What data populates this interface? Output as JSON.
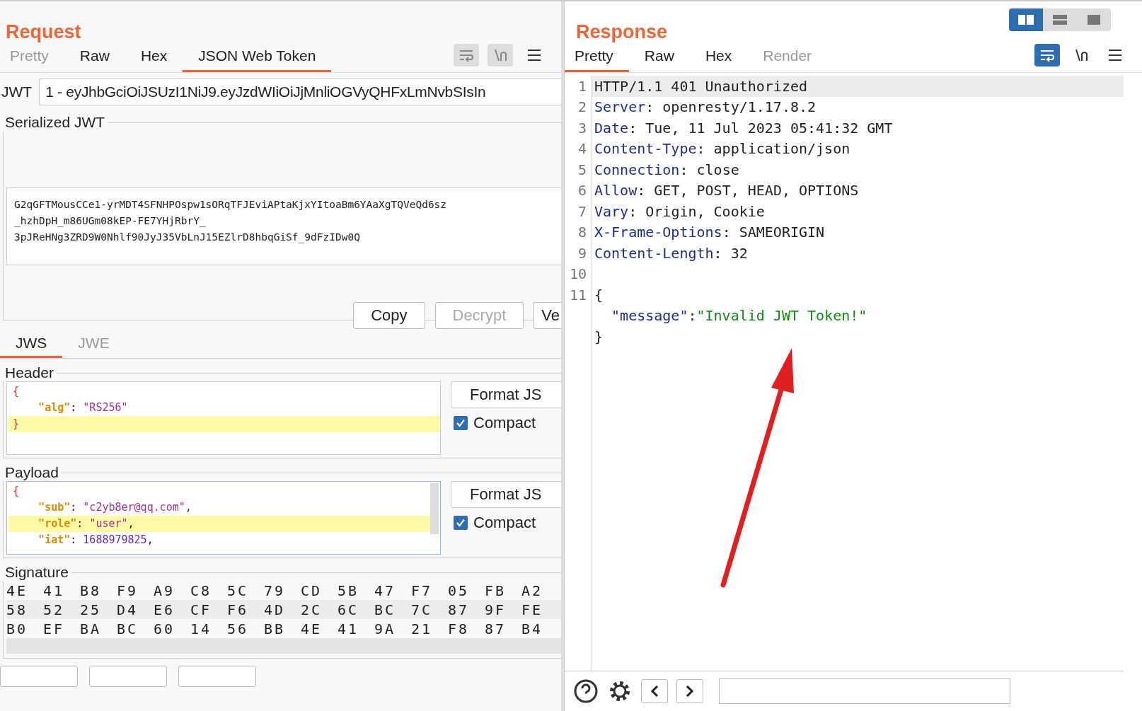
{
  "request": {
    "title": "Request",
    "tabs": [
      {
        "label": "Pretty",
        "selected": false,
        "disabled": true
      },
      {
        "label": "Raw",
        "selected": false,
        "disabled": false
      },
      {
        "label": "Hex",
        "selected": false,
        "disabled": false
      },
      {
        "label": "JSON Web Token",
        "selected": true,
        "disabled": false
      }
    ],
    "toolbar": [
      {
        "kind": "wrap",
        "on": false,
        "disabled": true
      },
      {
        "kind": "newline",
        "on": false,
        "disabled": true
      },
      {
        "kind": "menu",
        "on": false,
        "disabled": false
      }
    ],
    "jwt_field": {
      "label": "JWT",
      "value": "1 - eyJhbGciOiJSUzI1NiJ9.eyJzdWIiOiJjMnliOGVyQHFxLmNvbSIsIn"
    },
    "serialized": {
      "legend": "Serialized JWT",
      "lines": [
        "G2qGFTMousCCe1-yrMDT4SFNHPOspw1sORqTFJEviAPtaKjxYItoaBm6YAaXgTQVeQd6sz",
        "_hzhDpH_m86UGm08kEP-FE7YHjRbrY_",
        "3pJReHNg3ZRD9W0Nhlf90JyJ35VbLnJ15EZlrD8hbqGiSf_9dFzIDw0Q"
      ],
      "buttons": [
        {
          "label": "Copy",
          "disabled": false
        },
        {
          "label": "Decrypt",
          "disabled": true
        },
        {
          "label": "Ve",
          "disabled": false
        }
      ]
    },
    "sub_tabs": [
      {
        "label": "JWS",
        "selected": true
      },
      {
        "label": "JWE",
        "selected": false
      }
    ],
    "header": {
      "legend": "Header",
      "format_button": "Format JS",
      "compact": {
        "label": "Compact",
        "checked": true
      },
      "lines": [
        {
          "highlighted": false,
          "tokens": [
            {
              "kind": "brace",
              "text": "{"
            }
          ]
        },
        {
          "highlighted": false,
          "tokens": [
            {
              "kind": "key",
              "text": "    \"alg\""
            },
            {
              "kind": "punct",
              "text": ": "
            },
            {
              "kind": "string",
              "text": "\"RS256\""
            }
          ]
        },
        {
          "highlighted": true,
          "tokens": [
            {
              "kind": "brace",
              "text": "}"
            }
          ]
        }
      ]
    },
    "payload": {
      "legend": "Payload",
      "format_button": "Format JS",
      "compact": {
        "label": "Compact",
        "checked": true
      },
      "lines": [
        {
          "highlighted": false,
          "tokens": [
            {
              "kind": "brace",
              "text": "{"
            }
          ]
        },
        {
          "highlighted": false,
          "tokens": [
            {
              "kind": "key",
              "text": "    \"sub\""
            },
            {
              "kind": "punct",
              "text": ": "
            },
            {
              "kind": "string",
              "text": "\"c2yb8er@qq.com\""
            },
            {
              "kind": "punct",
              "text": ","
            }
          ]
        },
        {
          "highlighted": true,
          "tokens": [
            {
              "kind": "key",
              "text": "    \"role\""
            },
            {
              "kind": "punct",
              "text": ": "
            },
            {
              "kind": "string",
              "text": "\"user\""
            },
            {
              "kind": "punct",
              "text": ","
            }
          ]
        },
        {
          "highlighted": false,
          "tokens": [
            {
              "kind": "key",
              "text": "    \"iat\""
            },
            {
              "kind": "punct",
              "text": ": "
            },
            {
              "kind": "number",
              "text": "1688979825"
            },
            {
              "kind": "punct",
              "text": ","
            }
          ]
        }
      ]
    },
    "signature": {
      "legend": "Signature",
      "rows": [
        [
          "4E",
          "41",
          "B8",
          "F9",
          "A9",
          "C8",
          "5C",
          "79",
          "CD",
          "5B",
          "47",
          "F7",
          "05",
          "FB",
          "A2"
        ],
        [
          "58",
          "52",
          "25",
          "D4",
          "E6",
          "CF",
          "F6",
          "4D",
          "2C",
          "6C",
          "BC",
          "7C",
          "87",
          "9F",
          "FE"
        ],
        [
          "B0",
          "EF",
          "BA",
          "BC",
          "60",
          "14",
          "56",
          "BB",
          "4E",
          "41",
          "9A",
          "21",
          "F8",
          "87",
          "B4"
        ]
      ]
    }
  },
  "response": {
    "title": "Response",
    "view_modes": [
      {
        "kind": "split",
        "selected": true
      },
      {
        "kind": "stacked",
        "selected": false
      },
      {
        "kind": "single",
        "selected": false
      }
    ],
    "tabs": [
      {
        "label": "Pretty",
        "selected": true,
        "disabled": false
      },
      {
        "label": "Raw",
        "selected": false,
        "disabled": false
      },
      {
        "label": "Hex",
        "selected": false,
        "disabled": false
      },
      {
        "label": "Render",
        "selected": false,
        "disabled": true
      }
    ],
    "toolbar": [
      {
        "kind": "wrap",
        "on": true,
        "disabled": false
      },
      {
        "kind": "newline",
        "on": false,
        "disabled": false
      },
      {
        "kind": "menu",
        "on": false,
        "disabled": false
      }
    ],
    "lines": [
      {
        "number": "1",
        "highlighted": true,
        "tokens": [
          {
            "kind": "text",
            "text": "HTTP/1.1 401 Unauthorized"
          }
        ]
      },
      {
        "number": "2",
        "highlighted": false,
        "tokens": [
          {
            "kind": "name",
            "text": "Server"
          },
          {
            "kind": "text",
            "text": ": openresty/1.17.8.2"
          }
        ]
      },
      {
        "number": "3",
        "highlighted": false,
        "tokens": [
          {
            "kind": "name",
            "text": "Date"
          },
          {
            "kind": "text",
            "text": ": Tue, 11 Jul 2023 05:41:32 GMT"
          }
        ]
      },
      {
        "number": "4",
        "highlighted": false,
        "tokens": [
          {
            "kind": "name",
            "text": "Content-Type"
          },
          {
            "kind": "text",
            "text": ": application/json"
          }
        ]
      },
      {
        "number": "5",
        "highlighted": false,
        "tokens": [
          {
            "kind": "name",
            "text": "Connection"
          },
          {
            "kind": "text",
            "text": ": close"
          }
        ]
      },
      {
        "number": "6",
        "highlighted": false,
        "tokens": [
          {
            "kind": "name",
            "text": "Allow"
          },
          {
            "kind": "text",
            "text": ": GET, POST, HEAD, OPTIONS"
          }
        ]
      },
      {
        "number": "7",
        "highlighted": false,
        "tokens": [
          {
            "kind": "name",
            "text": "Vary"
          },
          {
            "kind": "text",
            "text": ": Origin, Cookie"
          }
        ]
      },
      {
        "number": "8",
        "highlighted": false,
        "tokens": [
          {
            "kind": "name",
            "text": "X-Frame-Options"
          },
          {
            "kind": "text",
            "text": ": SAMEORIGIN"
          }
        ]
      },
      {
        "number": "9",
        "highlighted": false,
        "tokens": [
          {
            "kind": "name",
            "text": "Content-Length"
          },
          {
            "kind": "text",
            "text": ": 32"
          }
        ]
      },
      {
        "number": "10",
        "highlighted": false
      },
      {
        "number": "11",
        "highlighted": false,
        "tokens": [
          {
            "kind": "text",
            "text": "{"
          }
        ]
      },
      {
        "highlighted": false,
        "tokens": [
          {
            "kind": "name",
            "text": "  \"message\""
          },
          {
            "kind": "text",
            "text": ":"
          },
          {
            "kind": "string",
            "text": "\"Invalid JWT Token!\""
          }
        ]
      },
      {
        "highlighted": false,
        "tokens": [
          {
            "kind": "text",
            "text": "}"
          }
        ]
      }
    ]
  }
}
